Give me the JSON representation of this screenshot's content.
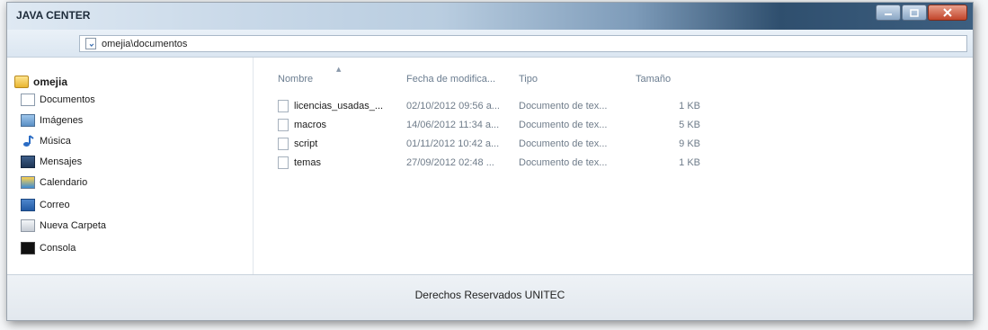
{
  "window": {
    "title": "JAVA CENTER",
    "controls": {
      "minimize": "minimize-icon",
      "maximize": "maximize-icon",
      "close": "close-icon"
    }
  },
  "address": {
    "path": "omejia\\documentos",
    "icon": "document-icon"
  },
  "sidebar": {
    "root": {
      "label": "omejia",
      "icon": "folder-icon"
    },
    "items": [
      {
        "label": "Documentos",
        "icon": "document-icon"
      },
      {
        "label": "Imágenes",
        "icon": "image-icon"
      },
      {
        "label": "Música",
        "icon": "music-icon"
      },
      {
        "label": "Mensajes",
        "icon": "messages-icon"
      },
      {
        "label": "Calendario",
        "icon": "calendar-icon"
      },
      {
        "label": "Correo",
        "icon": "mail-icon"
      },
      {
        "label": "Nueva Carpeta",
        "icon": "folder-icon"
      },
      {
        "label": "Consola",
        "icon": "console-icon"
      }
    ]
  },
  "files": {
    "columns": [
      "Nombre",
      "Fecha de modifica...",
      "Tipo",
      "Tamaño"
    ],
    "rows": [
      {
        "name": "licencias_usadas_...",
        "date": "02/10/2012 09:56 a...",
        "type": "Documento de tex...",
        "size": "1 KB"
      },
      {
        "name": "macros",
        "date": "14/06/2012 11:34 a...",
        "type": "Documento de tex...",
        "size": "5 KB"
      },
      {
        "name": "script",
        "date": "01/11/2012 10:42 a...",
        "type": "Documento de tex...",
        "size": "9 KB"
      },
      {
        "name": "temas",
        "date": "27/09/2012 02:48 ...",
        "type": "Documento de tex...",
        "size": "1 KB"
      }
    ]
  },
  "footer": {
    "text": "Derechos Reservados UNITEC"
  },
  "colors": {
    "titlebar_dark": "#2f4f6e",
    "close_button": "#c2452a",
    "muted_text": "#6f7c8a"
  }
}
